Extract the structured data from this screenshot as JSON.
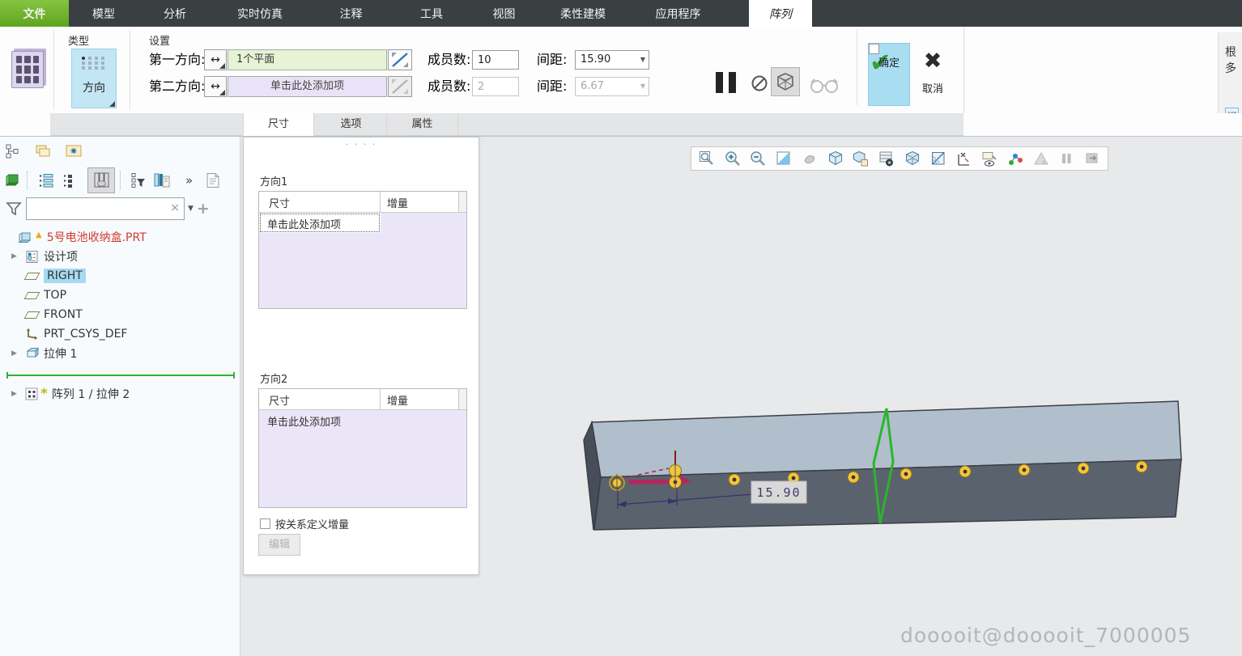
{
  "menu": {
    "tabs": [
      "文件",
      "模型",
      "分析",
      "实时仿真",
      "注释",
      "工具",
      "视图",
      "柔性建模",
      "应用程序",
      "阵列"
    ]
  },
  "ribbon": {
    "type_group_label": "类型",
    "settings_group_label": "设置",
    "direction_button_label": "方向",
    "first_direction_label": "第一方向:",
    "first_direction_value": "1个平面",
    "second_direction_label": "第二方向:",
    "second_direction_placeholder": "单击此处添加项",
    "members1_label": "成员数:",
    "members1_value": "10",
    "spacing1_label": "间距:",
    "spacing1_value": "15.90",
    "members2_label": "成员数:",
    "members2_value": "2",
    "spacing2_label": "间距:",
    "spacing2_value": "6.67",
    "ok_label": "确定",
    "cancel_label": "取消"
  },
  "side_panel": {
    "line1": "根",
    "line2": "多",
    "badge": "阅"
  },
  "panel_tabs": [
    "尺寸",
    "选项",
    "属性"
  ],
  "dialog": {
    "drag_handle": "· · · ·",
    "direction1_label": "方向1",
    "direction2_label": "方向2",
    "col_dimension": "尺寸",
    "col_increment": "增量",
    "add_item_text": "单击此处添加项",
    "relation_checkbox_label": "按关系定义增量",
    "edit_button_label": "编辑"
  },
  "tree": {
    "items": [
      {
        "label": "5号电池收纳盒.PRT",
        "state": "warning"
      },
      {
        "label": "设计项"
      },
      {
        "label": "RIGHT",
        "state": "selected"
      },
      {
        "label": "TOP"
      },
      {
        "label": "FRONT"
      },
      {
        "label": "PRT_CSYS_DEF"
      },
      {
        "label": "拉伸 1"
      },
      {
        "label": "阵列 1 / 拉伸 2",
        "state": "new"
      }
    ]
  },
  "model": {
    "dimension_label": "15.90",
    "pattern_instance_count": 10
  },
  "watermark": "dooooit@dooooit_7000005",
  "icons": {
    "swap_arrow": "↔",
    "dropdown_arrow": "▼",
    "clear": "×",
    "add": "+",
    "chevrons": "»",
    "ok_check": "✔",
    "cancel_cross": "✖",
    "tree_caret": "▶",
    "warning_triangle": "▲",
    "new_asterisk": "*"
  },
  "colors": {
    "accent_green": "#6eb22b",
    "collector_green": "#e6f4d5",
    "collector_purple": "#e9e3f7",
    "ok_highlight": "#a9ddf2",
    "selection_blue": "#a6d9f2",
    "insert_line_green": "#34b134",
    "pattern_dot_yellow": "#f2c53d",
    "direction_arrow_magenta": "#b5275e",
    "dimension_navy": "#3a3366"
  }
}
